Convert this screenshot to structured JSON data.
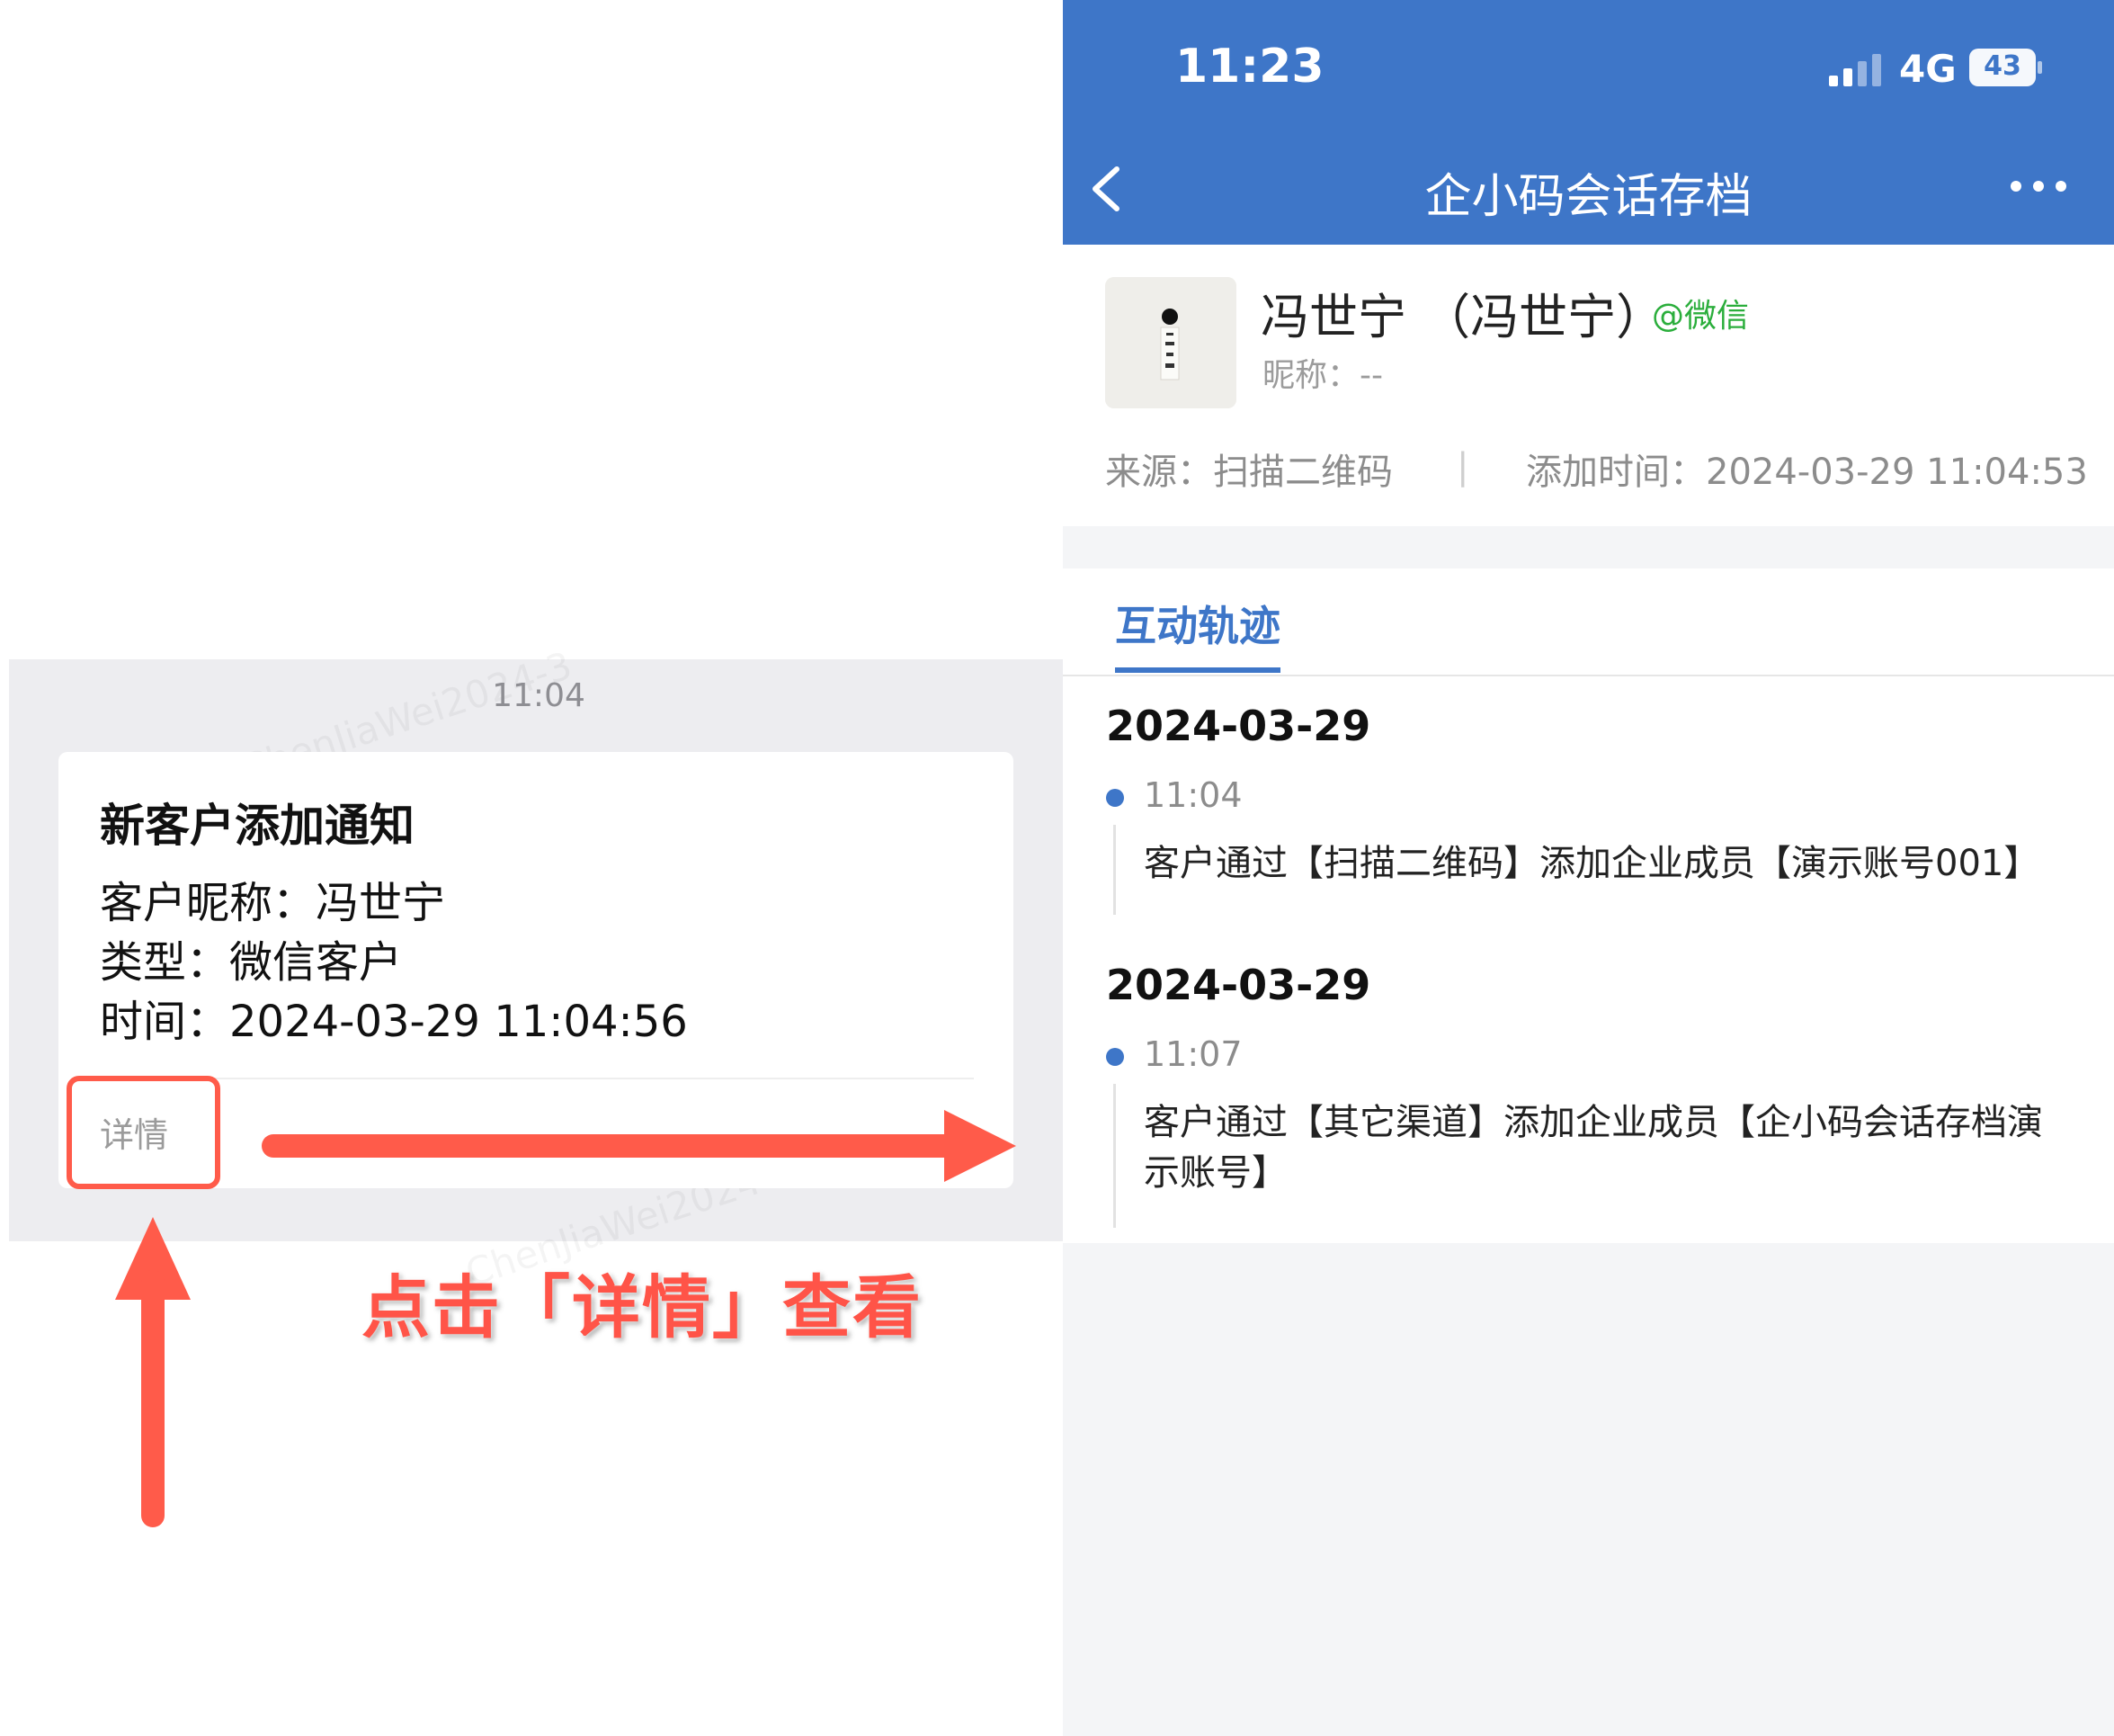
{
  "chat": {
    "time": "11:04",
    "watermark": "ChenJiaWei2024-3",
    "card_title": "新客户添加通知",
    "nickname_line": "客户昵称：冯世宁",
    "type_line": "类型：微信客户",
    "time_line": "时间：2024-03-29 11:04:56",
    "detail_label": "详情"
  },
  "instruction": "点击「详情」查看",
  "annotation_color": "#ff5b4a",
  "phone": {
    "status": {
      "time": "11:23",
      "network": "4G",
      "battery": "43"
    },
    "nav": {
      "title": "企小码会话存档",
      "back_icon": "chevron-left-icon",
      "more_icon": "more-dots-icon"
    },
    "profile": {
      "name": "冯世宁 （冯世宁）",
      "tag": "@微信",
      "nickname": "昵称：--",
      "source": "来源：扫描二维码",
      "separator": "|",
      "added_time": "添加时间：2024-03-29 11:04:53"
    },
    "tabs": [
      {
        "label": "互动轨迹",
        "active": true
      }
    ],
    "timeline": [
      {
        "date": "2024-03-29",
        "time": "11:04",
        "text": "客户通过【扫描二维码】添加企业成员【演示账号001】"
      },
      {
        "date": "2024-03-29",
        "time": "11:07",
        "text": "客户通过【其它渠道】添加企业成员【企小码会话存档演示账号】"
      }
    ],
    "brand_color": "#3e76c8",
    "tag_color": "#2bae3c"
  }
}
